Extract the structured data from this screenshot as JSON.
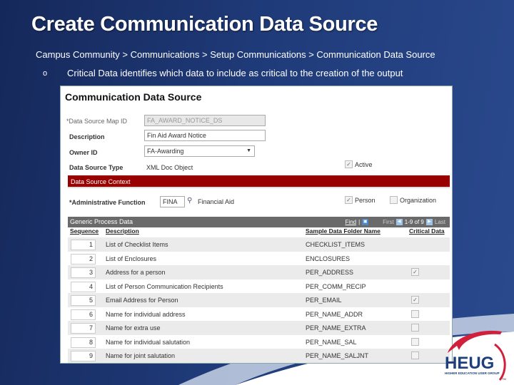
{
  "slide": {
    "title": "Create Communication Data Source",
    "breadcrumb": "Campus Community > Communications > Setup Communications > Communication Data Source",
    "bullet_marker": "o",
    "bullet_text": "Critical Data identifies which data to include as critical to the creation of the output"
  },
  "page": {
    "title": "Communication Data Source",
    "fields": {
      "map_id_label": "*Data Source Map ID",
      "map_id_value": "FA_AWARD_NOTICE_DS",
      "description_label": "Description",
      "description_value": "Fin Aid Award Notice",
      "owner_label": "Owner ID",
      "owner_value": "FA-Awarding",
      "type_label": "Data Source Type",
      "type_value": "XML Doc Object",
      "active_label": "Active",
      "active_checked": true
    },
    "context": {
      "section_title": "Data Source Context",
      "admin_function_label": "*Administrative Function",
      "admin_function_value": "FINA",
      "admin_function_desc": "Financial Aid",
      "person_label": "Person",
      "person_checked": true,
      "organization_label": "Organization",
      "organization_checked": false
    },
    "grid": {
      "title": "Generic Process Data",
      "find_label": "Find",
      "first_label": "First",
      "range_label": "1-9 of 9",
      "last_label": "Last",
      "columns": [
        "Sequence",
        "Description",
        "Sample Data Folder Name",
        "Critical Data"
      ],
      "rows": [
        {
          "seq": "1",
          "desc": "List of Checklist Items",
          "folder": "CHECKLIST_ITEMS",
          "critical": null
        },
        {
          "seq": "2",
          "desc": "List of Enclosures",
          "folder": "ENCLOSURES",
          "critical": null
        },
        {
          "seq": "3",
          "desc": "Address for a person",
          "folder": "PER_ADDRESS",
          "critical": true
        },
        {
          "seq": "4",
          "desc": "List of Person Communication Recipients",
          "folder": "PER_COMM_RECIP",
          "critical": null
        },
        {
          "seq": "5",
          "desc": "Email Address for Person",
          "folder": "PER_EMAIL",
          "critical": true
        },
        {
          "seq": "6",
          "desc": "Name for individual address",
          "folder": "PER_NAME_ADDR",
          "critical": false
        },
        {
          "seq": "7",
          "desc": "Name for extra use",
          "folder": "PER_NAME_EXTRA",
          "critical": false
        },
        {
          "seq": "8",
          "desc": "Name for individual salutation",
          "folder": "PER_NAME_SAL",
          "critical": false
        },
        {
          "seq": "9",
          "desc": "Name for joint salutation",
          "folder": "PER_NAME_SALJNT",
          "critical": false
        }
      ]
    }
  },
  "logo": {
    "name": "HEUG",
    "tagline": "HIGHER EDUCATION USER GROUP",
    "tm": "TM",
    "color": "#d0203c"
  }
}
